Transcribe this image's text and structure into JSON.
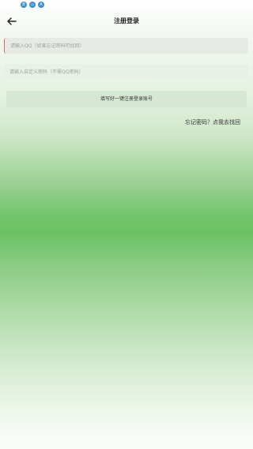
{
  "status_bar": {
    "icons": [
      {
        "name": "notification-b-icon",
        "glyph": "B"
      },
      {
        "name": "notification-d-icon",
        "glyph": "▫"
      },
      {
        "name": "notification-a-icon",
        "glyph": "A"
      }
    ]
  },
  "header": {
    "title": "注册登录",
    "back_icon": "arrow-left-icon"
  },
  "form": {
    "qq_placeholder": "请输入QQ（如果忘记密码可找回）",
    "qq_value": "",
    "password_placeholder": "请输入自定义密码（不需QQ密码）",
    "password_value": "",
    "submit_label": "填写好一键注册登录账号"
  },
  "forgot_link": "忘记密码？点我去找回",
  "colors": {
    "accent_green": "#6cc165",
    "status_icon_blue": "#3a8fd9",
    "field_bg": "#e5ebe4",
    "button_bg": "#d5e8d1"
  }
}
